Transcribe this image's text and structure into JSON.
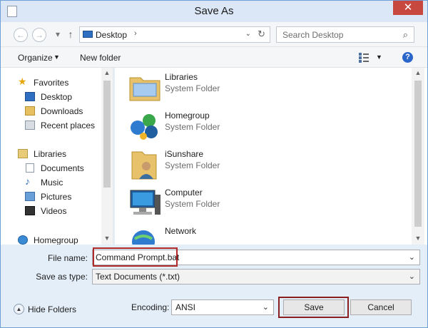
{
  "window": {
    "title": "Save As",
    "close_glyph": "✕"
  },
  "address": {
    "location": "Desktop",
    "search_placeholder": "Search Desktop"
  },
  "toolbar": {
    "organize": "Organize",
    "new_folder": "New folder"
  },
  "nav": {
    "items": [
      {
        "label": "Favorites",
        "icon": "star-icon"
      },
      {
        "label": "Desktop",
        "icon": "desktop-icon"
      },
      {
        "label": "Downloads",
        "icon": "downloads-icon"
      },
      {
        "label": "Recent places",
        "icon": "recent-places-icon"
      },
      {
        "label": "Libraries",
        "icon": "libraries-icon"
      },
      {
        "label": "Documents",
        "icon": "documents-icon"
      },
      {
        "label": "Music",
        "icon": "music-icon"
      },
      {
        "label": "Pictures",
        "icon": "pictures-icon"
      },
      {
        "label": "Videos",
        "icon": "videos-icon"
      },
      {
        "label": "Homegroup",
        "icon": "homegroup-icon"
      }
    ]
  },
  "files": [
    {
      "name": "Libraries",
      "type": "System Folder",
      "icon": "libraries-folder-icon"
    },
    {
      "name": "Homegroup",
      "type": "System Folder",
      "icon": "homegroup-icon"
    },
    {
      "name": "iSunshare",
      "type": "System Folder",
      "icon": "user-folder-icon"
    },
    {
      "name": "Computer",
      "type": "System Folder",
      "icon": "computer-icon"
    },
    {
      "name": "Network",
      "type": "",
      "icon": "network-icon"
    }
  ],
  "form": {
    "file_name_label": "File name:",
    "file_name_value": "Command Prompt.bat",
    "save_type_label": "Save as type:",
    "save_type_value": "Text Documents (*.txt)",
    "hide_folders": "Hide Folders",
    "encoding_label": "Encoding:",
    "encoding_value": "ANSI",
    "save": "Save",
    "cancel": "Cancel"
  },
  "colors": {
    "accent": "#2a66c9",
    "highlight_border": "#b02a2a",
    "window_frame": "#dbe7f6"
  }
}
